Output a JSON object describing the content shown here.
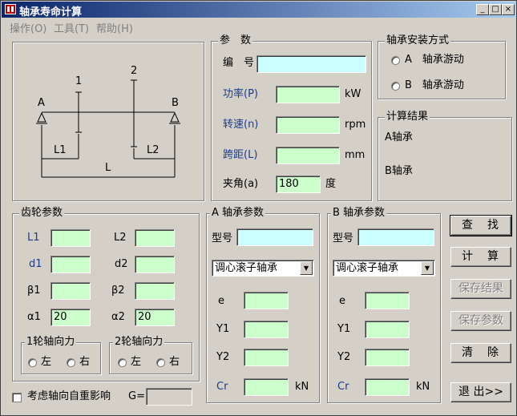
{
  "window": {
    "title": "轴承寿命计算",
    "controls": [
      "_",
      "□",
      "×"
    ]
  },
  "menu": [
    "操作(O)",
    "工具(T)",
    "帮助(H)"
  ],
  "diagram": {
    "A": "A",
    "B": "B",
    "g1": "1",
    "g2": "2",
    "L1": "L1",
    "L2": "L2",
    "L": "L"
  },
  "params": {
    "title": "参　数",
    "id_label": "编　号",
    "id_value": "",
    "power_label": "功率(P)",
    "power_value": "",
    "power_unit": "kW",
    "speed_label": "转速(n)",
    "speed_value": "",
    "speed_unit": "rpm",
    "span_label": "跨距(L)",
    "span_value": "",
    "span_unit": "mm",
    "angle_label": "夹角(a)",
    "angle_value": "180",
    "angle_unit": "度"
  },
  "mount": {
    "title": "轴承安装方式",
    "optA": "A　轴承游动",
    "optB": "B　轴承游动"
  },
  "result": {
    "title": "计算结果",
    "a": "A轴承",
    "b": "B轴承"
  },
  "gear": {
    "title": "齿轮参数",
    "L1": "L1",
    "L1_value": "",
    "L2": "L2",
    "L2_value": "",
    "d1": "d1",
    "d1_value": "",
    "d2": "d2",
    "d2_value": "",
    "b1": "β1",
    "b1_value": "",
    "b2": "β2",
    "b2_value": "",
    "a1": "α1",
    "a1_value": "20",
    "a2": "α2",
    "a2_value": "20",
    "force1_title": "1轮轴向力",
    "force2_title": "2轮轴向力",
    "left": "左",
    "right": "右"
  },
  "bearingA": {
    "title": "A 轴承参数",
    "model_label": "型号",
    "model_value": "",
    "type": "调心滚子轴承",
    "e": "e",
    "Y1": "Y1",
    "Y2": "Y2",
    "Cr": "Cr",
    "unit": "kN"
  },
  "bearingB": {
    "title": "B 轴承参数",
    "model_label": "型号",
    "model_value": "",
    "type": "调心滚子轴承",
    "e": "e",
    "Y1": "Y1",
    "Y2": "Y2",
    "Cr": "Cr",
    "unit": "kN"
  },
  "gravity": {
    "label": "考虑轴向自重影响",
    "g_label": "G=",
    "g_value": ""
  },
  "buttons": {
    "find": "查　找",
    "calc": "计　算",
    "save_result": "保存结果",
    "save_params": "保存参数",
    "clear": "清　除",
    "exit": "退 出>>"
  }
}
